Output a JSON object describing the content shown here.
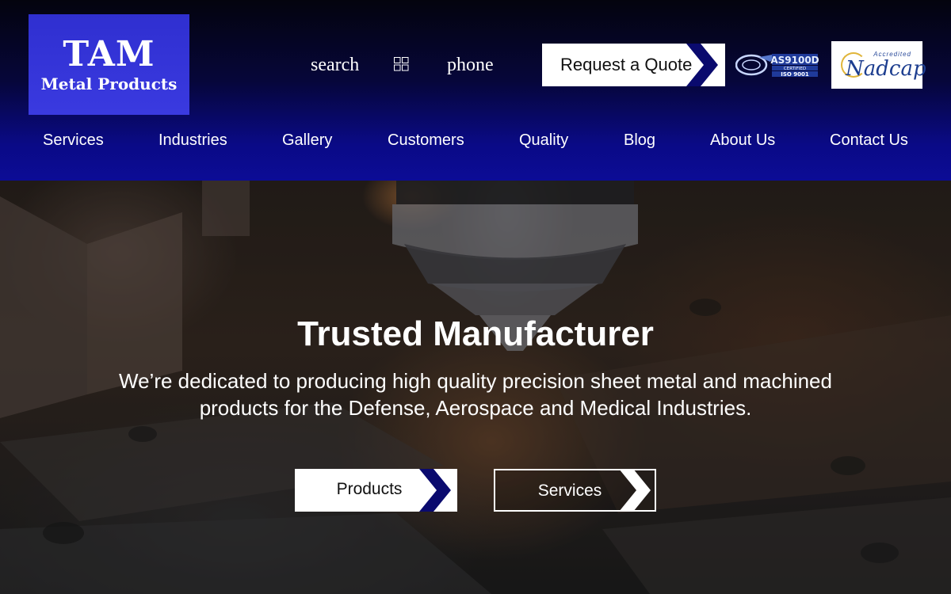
{
  "brand": {
    "name": "TAM",
    "tagline": "Metal Products"
  },
  "utility": {
    "search_label": "search",
    "menu_icon": "grid-icon",
    "phone_label": "phone"
  },
  "cta": {
    "quote_label": "Request a Quote"
  },
  "certifications": {
    "as9100_main": "AS9100D",
    "as9100_line1": "CERTIFIED",
    "as9100_line2": "ISO 9001",
    "nadcap_top": "Accredited",
    "nadcap_word": "Nadcap"
  },
  "nav": {
    "items": [
      {
        "label": "Services"
      },
      {
        "label": "Industries"
      },
      {
        "label": "Gallery"
      },
      {
        "label": "Customers"
      },
      {
        "label": "Quality"
      },
      {
        "label": "Blog"
      },
      {
        "label": "About Us"
      },
      {
        "label": "Contact Us"
      }
    ]
  },
  "hero": {
    "title": "Trusted Manufacturer",
    "description": "We’re dedicated to producing high quality precision sheet metal and machined products for the Defense, Aerospace and Medical Industries.",
    "buttons": {
      "products": "Products",
      "services": "Services"
    }
  },
  "colors": {
    "brand_blue": "#3a3ae0",
    "nav_blue": "#0c0c96",
    "chevron_navy": "#0a0a6e",
    "text_white": "#ffffff"
  }
}
